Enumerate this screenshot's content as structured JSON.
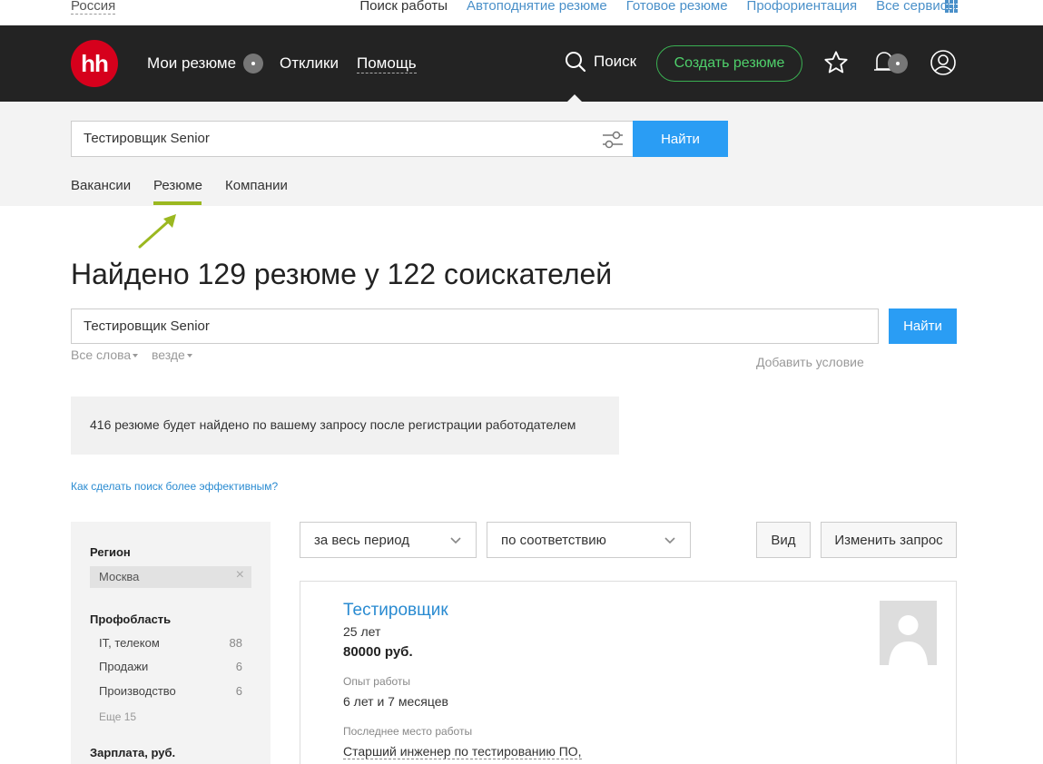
{
  "topbar": {
    "region": "Россия",
    "links": [
      "Поиск работы",
      "Автоподнятие резюме",
      "Готовое резюме",
      "Профориентация",
      "Все сервисы"
    ]
  },
  "header": {
    "logo": "hh",
    "my_resumes": "Мои резюме",
    "responses": "Отклики",
    "help": "Помощь",
    "search": "Поиск",
    "create_resume": "Создать резюме",
    "icons": [
      "star-icon",
      "bell-icon",
      "user-icon"
    ]
  },
  "search_band": {
    "query": "Тестировщик Senior",
    "find": "Найти",
    "tabs": [
      "Вакансии",
      "Резюме",
      "Компании"
    ],
    "active_tab": "Резюме"
  },
  "main": {
    "heading": "Найдено 129 резюме у 122 соискателей",
    "query": "Тестировщик Senior",
    "find": "Найти",
    "all_words": "Все слова",
    "everywhere": "везде",
    "add_condition": "Добавить условие",
    "notice": "416 резюме будет найдено по вашему запросу после регистрации работодателем",
    "howto": "Как сделать поиск более эффективным?"
  },
  "sidebar": {
    "region_title": "Регион",
    "region_chip": "Москва",
    "prof_title": "Профобласть",
    "prof_items": [
      {
        "label": "IT, телеком",
        "count": "88"
      },
      {
        "label": "Продажи",
        "count": "6"
      },
      {
        "label": "Производство",
        "count": "6"
      }
    ],
    "more": "Еще 15",
    "salary_title": "Зарплата, руб."
  },
  "filters": {
    "period": "за весь период",
    "sort": "по соответствию",
    "view": "Вид",
    "change_query": "Изменить запрос"
  },
  "result": {
    "title": "Тестировщик",
    "age": "25 лет",
    "salary": "80000 руб.",
    "exp_label": "Опыт работы",
    "exp_value": "6 лет и 7 месяцев",
    "last_label": "Последнее место работы",
    "last_value": "Старший инженер по тестированию ПО,"
  },
  "colors": {
    "header_bg": "#232323",
    "brand_red": "#d6001c",
    "accent_blue": "#2a9df4",
    "green": "#4fd06b",
    "tab_underline": "#9bb820"
  }
}
